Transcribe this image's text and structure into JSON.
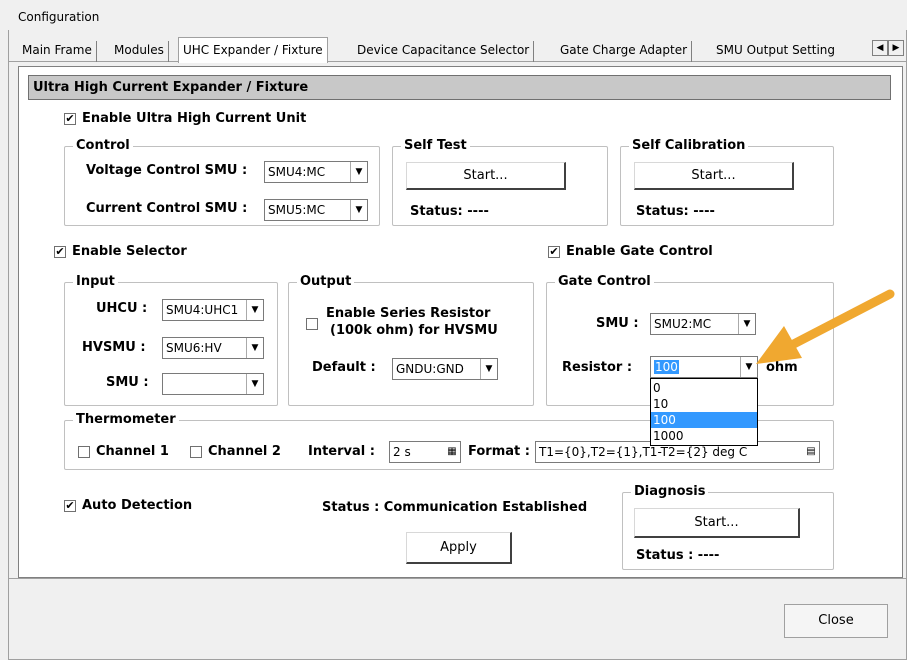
{
  "window": {
    "title": "Configuration"
  },
  "tabs": [
    {
      "label": "Main Frame"
    },
    {
      "label": "Modules"
    },
    {
      "label": "UHC Expander / Fixture"
    },
    {
      "label": "Device Capacitance Selector"
    },
    {
      "label": "Gate Charge Adapter"
    },
    {
      "label": "SMU Output Setting"
    }
  ],
  "panel": {
    "header": "Ultra High Current Expander / Fixture",
    "enable_uhc": {
      "label": "Enable Ultra High Current Unit",
      "checked": true
    },
    "control": {
      "legend": "Control",
      "voltage_label": "Voltage Control SMU :",
      "voltage_value": "SMU4:MC",
      "current_label": "Current Control SMU :",
      "current_value": "SMU5:MC"
    },
    "self_test": {
      "legend": "Self Test",
      "button": "Start...",
      "status": "Status: ----"
    },
    "self_calibration": {
      "legend": "Self Calibration",
      "button": "Start...",
      "status": "Status: ----"
    },
    "enable_selector": {
      "label": "Enable Selector",
      "checked": true
    },
    "input": {
      "legend": "Input",
      "uhcu_label": "UHCU :",
      "uhcu_value": "SMU4:UHC1",
      "hvsmu_label": "HVSMU :",
      "hvsmu_value": "SMU6:HV",
      "smu_label": "SMU :",
      "smu_value": ""
    },
    "output": {
      "legend": "Output",
      "series_resistor_line1": "Enable Series Resistor",
      "series_resistor_line2": "(100k ohm) for HVSMU",
      "series_checked": false,
      "default_label": "Default :",
      "default_value": "GNDU:GND"
    },
    "enable_gate_control": {
      "label": "Enable Gate Control",
      "checked": true
    },
    "gate_control": {
      "legend": "Gate Control",
      "smu_label": "SMU :",
      "smu_value": "SMU2:MC",
      "resistor_label": "Resistor :",
      "resistor_value": "100",
      "unit": "ohm",
      "options": [
        "0",
        "10",
        "100",
        "1000"
      ],
      "highlighted": "100"
    },
    "thermometer": {
      "legend": "Thermometer",
      "channel1": "Channel 1",
      "channel1_checked": false,
      "channel2": "Channel 2",
      "channel2_checked": false,
      "interval_label": "Interval :",
      "interval_value": "2 s",
      "format_label": "Format :",
      "format_value": "T1={0},T2={1},T1-T2={2} deg C"
    },
    "auto_detection": {
      "label": "Auto Detection",
      "checked": true
    },
    "status_text": "Status : Communication Established",
    "apply_button": "Apply",
    "diagnosis": {
      "legend": "Diagnosis",
      "button": "Start...",
      "status": "Status : ----"
    }
  },
  "footer": {
    "close_button": "Close"
  },
  "annotation": {
    "arrow_color": "#f0a830"
  },
  "icons": {
    "checkmark": "☑",
    "arrow_down": "▼",
    "arrow_left": "◀",
    "arrow_right": "▶",
    "calculator": "▦",
    "keyboard": "▤"
  }
}
